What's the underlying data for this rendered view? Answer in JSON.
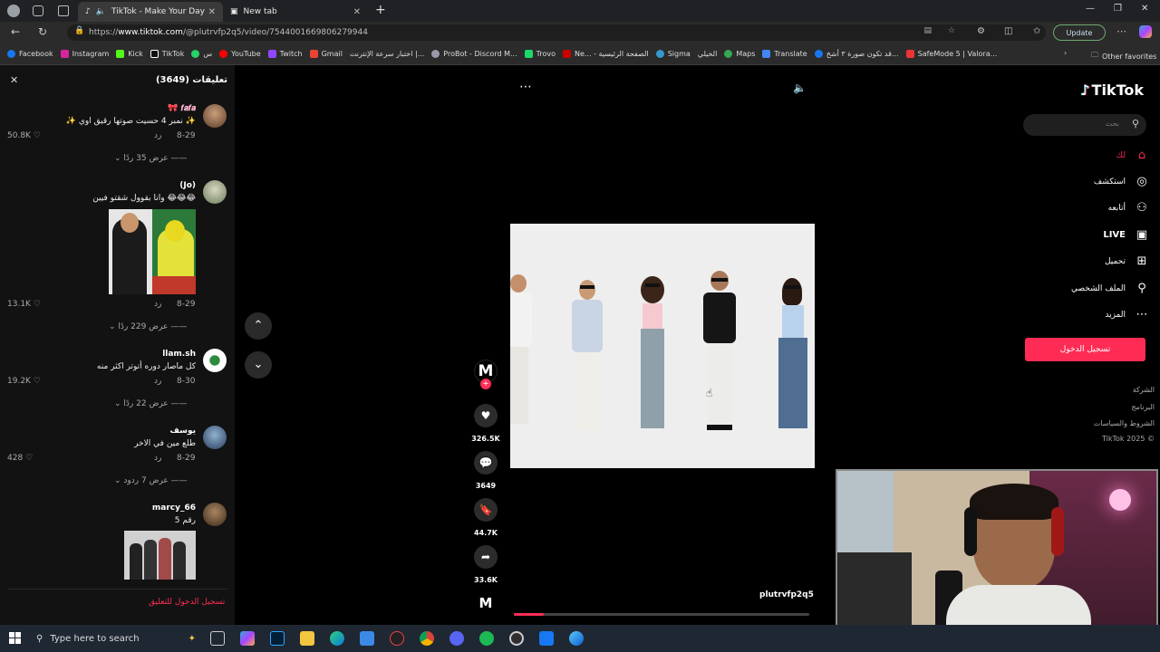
{
  "browser": {
    "tabs": [
      {
        "label": "TikTok - Make Your Day",
        "active": true
      },
      {
        "label": "New tab",
        "active": false
      }
    ],
    "url_prefix": "https://",
    "url_domain": "www.tiktok.com",
    "url_path": "/@plutrvfp2q5/video/7544001669806279944",
    "update_label": "Update",
    "bookmarks": [
      "Facebook",
      "Instagram",
      "Kick",
      "TikTok",
      "س",
      "YouTube",
      "Twitch",
      "Gmail",
      "اختبار سرعة الإنترنت |...",
      "ProBot - Discord M...",
      "Trovo",
      "Ne... - الصفحة الرئيسية",
      "Sigma",
      "الخيلي",
      "Maps",
      "Translate",
      "قد تكون صورة ٣ أشخ...",
      "SafeMode 5 | Valora..."
    ],
    "other_favorites": "Other favorites"
  },
  "comments": {
    "title": "تعليقات (3649)",
    "items": [
      {
        "name": "🎀 𝒇𝒂𝒇𝒂",
        "text": "✨ نمبر 4 حسيت صوتها رقيق اوي ✨",
        "date": "8-29",
        "reply": "رد",
        "likes": "50.8K",
        "view_replies": "عرض 35 ردًا"
      },
      {
        "name": "(Jo)",
        "text": "وانا بقوول شقتو فيين 😂😂😂",
        "date": "8-29",
        "reply": "رد",
        "likes": "13.1K",
        "view_replies": "عرض 229 ردًا"
      },
      {
        "name": "llam.sh",
        "text": "كل ماصار دوره أتوتر اكثر منه",
        "date": "8-30",
        "reply": "رد",
        "likes": "19.2K",
        "view_replies": "عرض 22 ردًا"
      },
      {
        "name": "يوسف",
        "text": "طلع مين في الاخر",
        "date": "8-29",
        "reply": "رد",
        "likes": "428",
        "view_replies": "عرض 7 ردود"
      },
      {
        "name": "marcy_66",
        "text": "رقم 5",
        "date": "",
        "reply": "",
        "likes": "",
        "view_replies": ""
      }
    ],
    "login_to_comment": "تسجيل الدخول للتعليق"
  },
  "video": {
    "author": "plutrvfp2q5",
    "avatar_letter": "M",
    "likes": "326.5K",
    "comments": "3649",
    "saves": "44.7K",
    "shares": "33.6K",
    "progress": 0.1
  },
  "sidebar": {
    "logo": "TikTok",
    "search_placeholder": "بحث",
    "items": [
      {
        "label": "لك",
        "icon": "home-icon"
      },
      {
        "label": "استكشف",
        "icon": "compass-icon"
      },
      {
        "label": "أتابعه",
        "icon": "user-follow-icon"
      },
      {
        "label": "LIVE",
        "icon": "live-icon"
      },
      {
        "label": "تحميل",
        "icon": "upload-icon"
      },
      {
        "label": "الملف الشخصي",
        "icon": "profile-icon"
      },
      {
        "label": "المزيد",
        "icon": "more-icon"
      }
    ],
    "login_button": "تسجيل الدخول",
    "footer": [
      "الشركة",
      "البرنامج",
      "الشروط والسياسات",
      "TikTok 2025 ©"
    ]
  },
  "taskbar": {
    "search_placeholder": "Type here to search"
  },
  "colors": {
    "accent": "#fe2c55",
    "panel": "#121212"
  }
}
